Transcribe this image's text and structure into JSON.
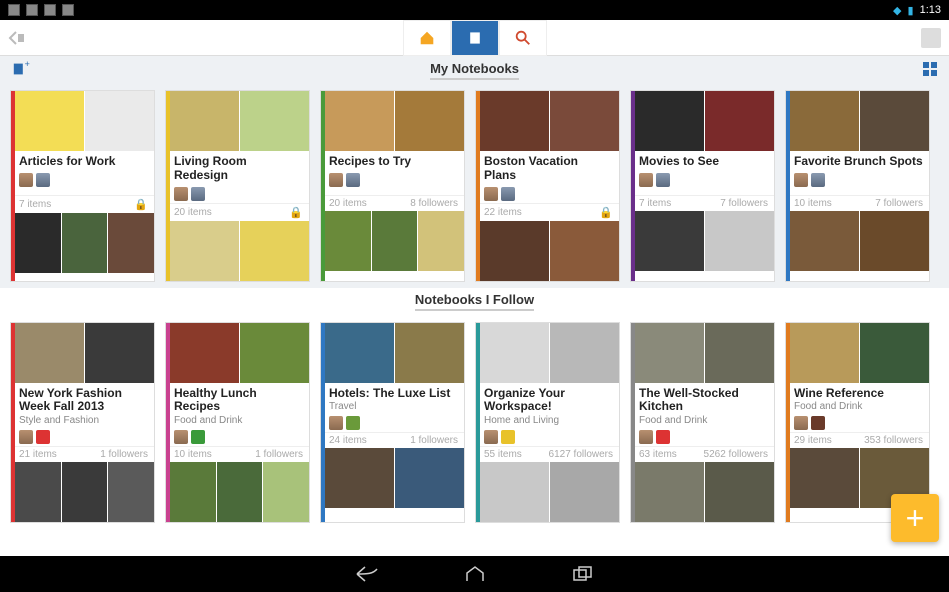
{
  "statusbar": {
    "time": "1:13"
  },
  "sections": {
    "mine": {
      "title": "My Notebooks"
    },
    "follow": {
      "title": "Notebooks I Follow"
    }
  },
  "colors": {
    "red": "#d33",
    "yellow": "#e8c22a",
    "green": "#4a9a3a",
    "orange": "#e07b1f",
    "purple": "#6a2f8a",
    "blue": "#2f78c2",
    "magenta": "#c9418f",
    "teal": "#2a9a9a",
    "gray": "#888"
  },
  "myNotebooks": [
    {
      "title": "Articles for Work",
      "items": "7 items",
      "followers": "",
      "locked": true,
      "spine": "red",
      "tops": [
        "#f3dd55",
        "#eaeaea"
      ],
      "bots": [
        "#2a2a2a",
        "#4a643d",
        "#6a4a3a"
      ]
    },
    {
      "title": "Living Room Redesign",
      "items": "20 items",
      "followers": "",
      "locked": true,
      "spine": "yellow",
      "tops": [
        "#c8b56a",
        "#bcd28a"
      ],
      "bots": [
        "#d9cd8b",
        "#e6d15a"
      ]
    },
    {
      "title": "Recipes to Try",
      "items": "20 items",
      "followers": "8 followers",
      "locked": false,
      "spine": "green",
      "tops": [
        "#c79a5a",
        "#a47a3a"
      ],
      "bots": [
        "#6a8a3a",
        "#5a7a3a",
        "#d2c27a"
      ]
    },
    {
      "title": "Boston Vacation Plans",
      "items": "22 items",
      "followers": "",
      "locked": true,
      "spine": "orange",
      "tops": [
        "#6a3a2a",
        "#7a4a3a"
      ],
      "bots": [
        "#5a3a2a",
        "#8a5a3a"
      ]
    },
    {
      "title": "Movies to See",
      "items": "7 items",
      "followers": "7 followers",
      "locked": false,
      "spine": "purple",
      "tops": [
        "#2a2a2a",
        "#7a2a2a"
      ],
      "bots": [
        "#3a3a3a",
        "#c8c8c8"
      ]
    },
    {
      "title": "Favorite Brunch Spots",
      "items": "10 items",
      "followers": "7 followers",
      "locked": false,
      "spine": "blue",
      "tops": [
        "#8a6a3a",
        "#5a4a3a"
      ],
      "bots": [
        "#7a5a3a",
        "#6a4a2a"
      ]
    }
  ],
  "followed": [
    {
      "title": "New York Fashion Week Fall 2013",
      "sub": "Style and Fashion",
      "items": "21 items",
      "followers": "1 followers",
      "spine": "red",
      "tops": [
        "#9a8a6a",
        "#3a3a3a"
      ],
      "bots": [
        "#4a4a4a",
        "#3a3a3a",
        "#5a5a5a"
      ],
      "badge": "#d33"
    },
    {
      "title": "Healthy Lunch Recipes",
      "sub": "Food and Drink",
      "items": "10 items",
      "followers": "1 followers",
      "spine": "magenta",
      "tops": [
        "#8a3a2a",
        "#6a8a3a"
      ],
      "bots": [
        "#5a7a3a",
        "#4a6a3a",
        "#a8c27a"
      ],
      "badge": "#3a9a3a"
    },
    {
      "title": "Hotels: The Luxe List",
      "sub": "Travel",
      "items": "24 items",
      "followers": "1 followers",
      "spine": "blue",
      "tops": [
        "#3a6a8a",
        "#8a7a4a"
      ],
      "bots": [
        "#5a4a3a",
        "#3a5a7a"
      ],
      "badge": "#6a9a3a"
    },
    {
      "title": "Organize Your Workspace!",
      "sub": "Home and Living",
      "items": "55 items",
      "followers": "6127 followers",
      "spine": "teal",
      "tops": [
        "#d8d8d8",
        "#b8b8b8"
      ],
      "bots": [
        "#c8c8c8",
        "#a8a8a8"
      ],
      "badge": "#e8c22a"
    },
    {
      "title": "The Well-Stocked Kitchen",
      "sub": "Food and Drink",
      "items": "63 items",
      "followers": "5262 followers",
      "spine": "gray",
      "tops": [
        "#8a8a7a",
        "#6a6a5a"
      ],
      "bots": [
        "#7a7a6a",
        "#5a5a4a"
      ],
      "badge": "#d33"
    },
    {
      "title": "Wine Reference",
      "sub": "Food and Drink",
      "items": "29 items",
      "followers": "353 followers",
      "spine": "orange",
      "tops": [
        "#b89a5a",
        "#3a5a3a"
      ],
      "bots": [
        "#5a4a3a",
        "#6a5a3a"
      ],
      "badge": "#6a3a2a"
    }
  ]
}
